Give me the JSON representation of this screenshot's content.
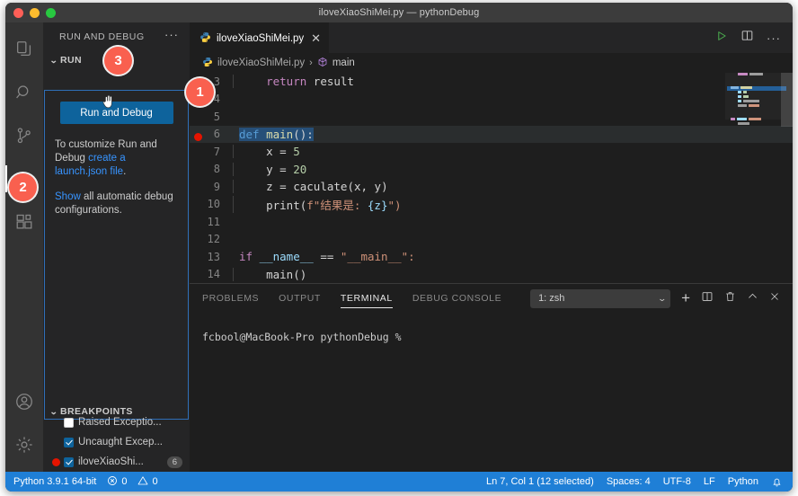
{
  "window": {
    "title": "iloveXiaoShiMei.py — pythonDebug",
    "traffic_lights": [
      "close-red",
      "minimize-yellow",
      "maximize-green"
    ]
  },
  "activitybar": {
    "items": [
      {
        "name": "explorer",
        "icon": "files-icon",
        "active": false
      },
      {
        "name": "search",
        "icon": "search-icon",
        "active": false
      },
      {
        "name": "source-control",
        "icon": "source-control-icon",
        "active": false
      },
      {
        "name": "run-and-debug",
        "icon": "run-debug-icon",
        "active": true
      },
      {
        "name": "extensions",
        "icon": "extensions-icon",
        "active": false
      }
    ],
    "bottom_items": [
      {
        "name": "accounts",
        "icon": "account-icon"
      },
      {
        "name": "settings",
        "icon": "gear-icon"
      }
    ]
  },
  "sidebar": {
    "header_title": "RUN AND DEBUG",
    "more_actions": "···",
    "run_section": {
      "title": "RUN",
      "chevron": "⌄",
      "run_button_label": "Run and Debug",
      "description_1a": "To customize Run and Debug ",
      "description_1b": "create a launch.json file",
      "description_1c": ".",
      "description_2a": "Show",
      "description_2b": " all automatic debug configurations."
    },
    "breakpoints_section": {
      "title": "BREAKPOINTS",
      "chevron": "⌄",
      "rows": [
        {
          "label": "Raised Exceptio...",
          "checked": false,
          "has_dot": false,
          "count": ""
        },
        {
          "label": "Uncaught Excep...",
          "checked": true,
          "has_dot": false,
          "count": ""
        },
        {
          "label": "iloveXiaoShi...",
          "checked": true,
          "has_dot": true,
          "count": "6"
        }
      ]
    }
  },
  "editor": {
    "tab": {
      "label": "iloveXiaoShiMei.py",
      "icon": "python-icon",
      "close": "✕"
    },
    "tab_actions": [
      {
        "name": "run-python-file",
        "icon": "play-icon",
        "glyph": "▷"
      },
      {
        "name": "split-editor",
        "icon": "split-editor-icon",
        "glyph": "▯"
      },
      {
        "name": "more-actions",
        "icon": "ellipsis-icon",
        "glyph": "···"
      }
    ],
    "breadcrumb": {
      "file": "iloveXiaoShiMei.py",
      "separator": "›",
      "symbol": "main",
      "symbol_icon": "symbol-method-icon"
    },
    "lines": [
      {
        "num": "3",
        "indent": true,
        "breakpoint": false,
        "highlight": false,
        "tokens": [
          {
            "t": "    ",
            "c": "plain"
          },
          {
            "t": "return",
            "c": "kw2"
          },
          {
            "t": " result",
            "c": "plain"
          }
        ]
      },
      {
        "num": "4",
        "indent": false,
        "breakpoint": false,
        "highlight": false,
        "tokens": []
      },
      {
        "num": "5",
        "indent": false,
        "breakpoint": false,
        "highlight": false,
        "tokens": []
      },
      {
        "num": "6",
        "indent": false,
        "breakpoint": true,
        "highlight": true,
        "tokens": [
          {
            "t": "def ",
            "c": "kw"
          },
          {
            "t": "main",
            "c": "fn"
          },
          {
            "t": "():",
            "c": "plain"
          }
        ]
      },
      {
        "num": "7",
        "indent": true,
        "breakpoint": false,
        "highlight": false,
        "tokens": [
          {
            "t": "    x = ",
            "c": "plain"
          },
          {
            "t": "5",
            "c": "num"
          }
        ]
      },
      {
        "num": "8",
        "indent": true,
        "breakpoint": false,
        "highlight": false,
        "tokens": [
          {
            "t": "    y = ",
            "c": "plain"
          },
          {
            "t": "20",
            "c": "num"
          }
        ]
      },
      {
        "num": "9",
        "indent": true,
        "breakpoint": false,
        "highlight": false,
        "tokens": [
          {
            "t": "    z = ",
            "c": "plain"
          },
          {
            "t": "caculate",
            "c": "plain"
          },
          {
            "t": "(x, y)",
            "c": "plain"
          }
        ]
      },
      {
        "num": "10",
        "indent": true,
        "breakpoint": false,
        "highlight": false,
        "tokens": [
          {
            "t": "    ",
            "c": "plain"
          },
          {
            "t": "print",
            "c": "plain"
          },
          {
            "t": "(",
            "c": "plain"
          },
          {
            "t": "f\"结果是: ",
            "c": "str"
          },
          {
            "t": "{z}",
            "c": "var"
          },
          {
            "t": "\")",
            "c": "str"
          }
        ]
      },
      {
        "num": "11",
        "indent": false,
        "breakpoint": false,
        "highlight": false,
        "tokens": []
      },
      {
        "num": "12",
        "indent": false,
        "breakpoint": false,
        "highlight": false,
        "tokens": []
      },
      {
        "num": "13",
        "indent": false,
        "breakpoint": false,
        "highlight": false,
        "tokens": [
          {
            "t": "if ",
            "c": "kw2"
          },
          {
            "t": "__name__",
            "c": "var"
          },
          {
            "t": " == ",
            "c": "plain"
          },
          {
            "t": "\"__main__\":",
            "c": "str"
          }
        ]
      },
      {
        "num": "14",
        "indent": true,
        "breakpoint": false,
        "highlight": false,
        "tokens": [
          {
            "t": "    main()",
            "c": "plain"
          }
        ]
      }
    ]
  },
  "panel": {
    "tabs": [
      {
        "label": "PROBLEMS",
        "active": false
      },
      {
        "label": "OUTPUT",
        "active": false
      },
      {
        "label": "TERMINAL",
        "active": true
      },
      {
        "label": "DEBUG CONSOLE",
        "active": false
      }
    ],
    "terminal_select": {
      "value": "1: zsh",
      "chevron": "⌄"
    },
    "actions": [
      {
        "name": "new-terminal",
        "icon": "plus-icon",
        "glyph": "+"
      },
      {
        "name": "split-terminal",
        "icon": "split-icon",
        "glyph": "▯"
      },
      {
        "name": "kill-terminal",
        "icon": "trash-icon",
        "glyph": "🗑"
      },
      {
        "name": "maximize-panel",
        "icon": "chevron-up-icon",
        "glyph": "⌃"
      },
      {
        "name": "close-panel",
        "icon": "close-icon",
        "glyph": "✕"
      }
    ],
    "terminal_prompt": "fcbool@MacBook-Pro pythonDebug %"
  },
  "statusbar": {
    "left": [
      {
        "name": "python-interpreter",
        "label": "Python 3.9.1 64-bit",
        "icon": ""
      },
      {
        "name": "error-count",
        "label": "0",
        "icon": "error-icon"
      },
      {
        "name": "warning-count",
        "label": "0",
        "icon": "warning-icon"
      }
    ],
    "right": [
      {
        "name": "cursor-position",
        "label": "Ln 7, Col 1 (12 selected)"
      },
      {
        "name": "indentation",
        "label": "Spaces: 4"
      },
      {
        "name": "encoding",
        "label": "UTF-8"
      },
      {
        "name": "eol",
        "label": "LF"
      },
      {
        "name": "language-mode",
        "label": "Python"
      },
      {
        "name": "notifications",
        "label": "",
        "icon": "bell-icon"
      }
    ]
  },
  "annotations": [
    {
      "id": "1",
      "label": "1"
    },
    {
      "id": "2",
      "label": "2"
    },
    {
      "id": "3",
      "label": "3"
    }
  ],
  "colors": {
    "accent_blue": "#0e639c",
    "statusbar_blue": "#1f7fd6",
    "badge_red": "#f9604f",
    "breakpoint_red": "#e51400",
    "editor_bg": "#1e1e1e",
    "sidebar_bg": "#252526",
    "activitybar_bg": "#333333",
    "titlebar_bg": "#3c3c3c"
  }
}
